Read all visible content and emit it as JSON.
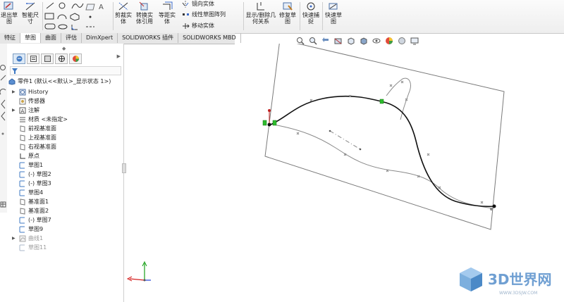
{
  "ribbon": {
    "exit_sketch": "退出草图",
    "smart_dimension": "智能尺寸",
    "trim_entities": "剪裁实体",
    "convert_entities": "转换实体引用",
    "offset_entities": "等距实体",
    "mirror_entities": "镜向实体",
    "linear_pattern": "线性草图阵列",
    "move_entities": "移动实体",
    "display_relations": "显示/删除几何关系",
    "repair_sketch": "修复草图",
    "quick_snaps": "快速捕捉",
    "rapid_sketch": "快速草图"
  },
  "tabs": [
    "特征",
    "草图",
    "曲面",
    "评估",
    "DimXpert",
    "SOLIDWORKS 插件",
    "SOLIDWORKS MBD"
  ],
  "active_tab": 1,
  "tree": {
    "root": "零件1  (默认<<默认>_显示状态 1>)",
    "items": [
      {
        "label": "History",
        "icon": "history-icon"
      },
      {
        "label": "传感器",
        "icon": "sensor-icon"
      },
      {
        "label": "注解",
        "icon": "annotation-icon"
      },
      {
        "label": "材质 <未指定>",
        "icon": "material-icon"
      },
      {
        "label": "前视基准面",
        "icon": "plane-icon"
      },
      {
        "label": "上视基准面",
        "icon": "plane-icon"
      },
      {
        "label": "右视基准面",
        "icon": "plane-icon"
      },
      {
        "label": "原点",
        "icon": "origin-icon"
      },
      {
        "label": "草图1",
        "icon": "sketch-icon"
      },
      {
        "label": "(-) 草图2",
        "icon": "sketch-icon"
      },
      {
        "label": "(-) 草图3",
        "icon": "sketch-icon"
      },
      {
        "label": "草图4",
        "icon": "sketch-icon"
      },
      {
        "label": "基准面1",
        "icon": "plane-icon"
      },
      {
        "label": "基准面2",
        "icon": "plane-icon"
      },
      {
        "label": "(-) 草图7",
        "icon": "sketch-icon"
      },
      {
        "label": "草图9",
        "icon": "sketch-icon"
      },
      {
        "label": "曲线1",
        "icon": "curve-icon"
      },
      {
        "label": "草图11",
        "icon": "sketch-icon"
      }
    ]
  },
  "watermark": {
    "brand": "3D世界网",
    "url": "WWW.3DSJW.COM"
  },
  "colors": {
    "curve": "#111111",
    "construction": "#8a8a8a",
    "endpoint_green": "#2dbb2d",
    "plane": "#7a7a7a",
    "axis_x": "#d62020",
    "axis_y": "#18a018",
    "axis_z": "#1f3fd6"
  }
}
